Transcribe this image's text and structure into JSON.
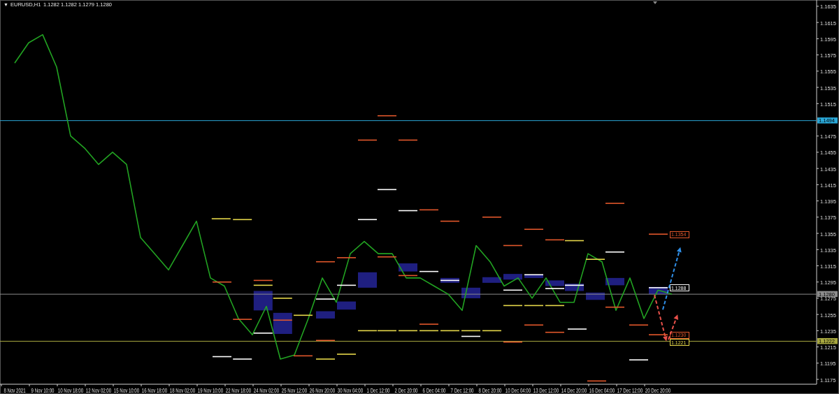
{
  "window": {
    "menu_glyph": "▼",
    "symbol": "EURUSD,H1",
    "ohlc": "1.1282 1.1282 1.1279 1.1280"
  },
  "chart": {
    "chart_data": {
      "type": "line",
      "ylim": [
        1.1169,
        1.1641
      ],
      "categories": [
        "8 Nov 2021",
        null,
        "9 Nov 10:00",
        null,
        "10 Nov 18:00",
        null,
        "12 Nov 02:00",
        null,
        "15 Nov 10:00",
        null,
        "16 Nov 18:00",
        null,
        "18 Nov 02:00",
        null,
        "19 Nov 10:00",
        null,
        "22 Nov 18:00",
        null,
        "24 Nov 02:00",
        null,
        "25 Nov 12:00",
        null,
        "26 Nov 20:00",
        null,
        "30 Nov 04:00",
        null,
        "1 Dec 12:00",
        null,
        "2 Dec 20:00",
        null,
        "6 Dec 04:00",
        null,
        "7 Dec 12:00",
        null,
        "8 Dec 20:00",
        null,
        "10 Dec 04:00",
        null,
        "13 Dec 12:00",
        null,
        "14 Dec 20:00",
        null,
        "16 Dec 04:00",
        null,
        "17 Dec 12:00",
        null,
        "20 Dec 20:00",
        null
      ],
      "series": [
        {
          "color": "#22a322",
          "values": [
            1.1565,
            1.159,
            1.16,
            1.156,
            1.1475,
            1.146,
            1.144,
            1.1455,
            1.144,
            1.135,
            1.133,
            1.131,
            1.134,
            1.137,
            1.13,
            1.129,
            1.125,
            1.123,
            1.1265,
            1.12,
            1.1205,
            1.125,
            1.13,
            1.127,
            1.133,
            1.1345,
            1.133,
            1.133,
            1.13,
            1.13,
            1.129,
            1.128,
            1.126,
            1.134,
            1.132,
            1.129,
            1.13,
            1.1275,
            1.13,
            1.127,
            1.127,
            1.133,
            1.132,
            1.126,
            1.13,
            1.125,
            1.1285,
            1.128
          ]
        }
      ],
      "yticks": [
        1.1635,
        1.1615,
        1.1595,
        1.1575,
        1.1555,
        1.1535,
        1.1515,
        1.1475,
        1.1455,
        1.1435,
        1.1415,
        1.1395,
        1.1375,
        1.1355,
        1.1335,
        1.1315,
        1.1295,
        1.1275,
        1.1255,
        1.1235,
        1.1215,
        1.1195,
        1.1175
      ],
      "ref_lines": [
        {
          "axis": "y",
          "value": 1.1494,
          "color": "#2aa8d8",
          "label": "1.1494"
        },
        {
          "axis": "y",
          "value": 1.128,
          "color": "#8c8c8c",
          "label": "1.1280"
        },
        {
          "axis": "y",
          "value": 1.1222,
          "color": "#a8a840",
          "label": "1.1222"
        }
      ]
    },
    "price_tags": [
      {
        "text": "1.1354",
        "color": "#e2572b"
      },
      {
        "text": "1.1288",
        "color": "#ffffff"
      },
      {
        "text": "1.1230",
        "color": "#e2572b"
      },
      {
        "text": "1.1221",
        "color": "#e6d84a"
      }
    ]
  }
}
